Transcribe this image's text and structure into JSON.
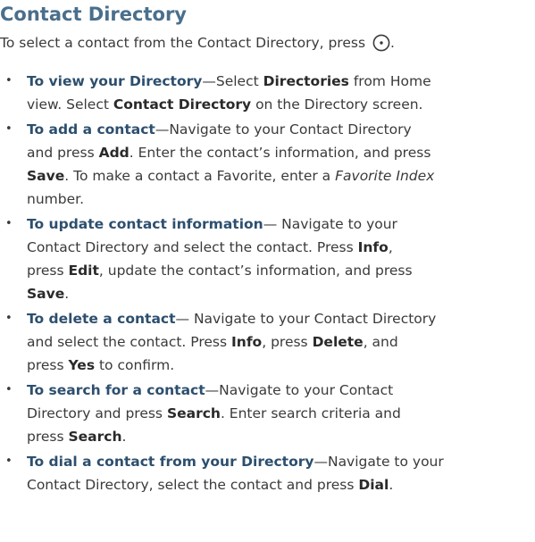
{
  "title": "Contact Directory",
  "intro": {
    "text": "To select a contact from the Contact Directory, press",
    "select_key_icon": "select-button-icon",
    "end": "."
  },
  "items": [
    {
      "lead": "To view your Directory",
      "lines": [
        [
          {
            "t": "—Select ",
            "k": false
          },
          {
            "t": "Directories",
            "k": true
          },
          {
            "t": " from Home",
            "k": false
          }
        ],
        [
          {
            "t": "view. Select ",
            "k": false
          },
          {
            "t": "Contact Directory",
            "k": true
          },
          {
            "t": " on the Directory screen.",
            "k": false
          }
        ]
      ]
    },
    {
      "lead": "To add a contact",
      "lines": [
        [
          {
            "t": "—Navigate to your Contact Directory",
            "k": false
          }
        ],
        [
          {
            "t": "and press ",
            "k": false
          },
          {
            "t": "Add",
            "k": true
          },
          {
            "t": ". Enter the contact’s information, and press",
            "k": false
          }
        ],
        [
          {
            "t": "Save",
            "k": true
          },
          {
            "t": ". To make a contact a Favorite, enter a ",
            "k": false
          },
          {
            "t": "Favorite Index",
            "k": false,
            "i": true
          }
        ],
        [
          {
            "t": "number.",
            "k": false
          }
        ]
      ]
    },
    {
      "lead": "To update contact information",
      "lines": [
        [
          {
            "t": "— Navigate to your",
            "k": false
          }
        ],
        [
          {
            "t": "Contact Directory and select the contact. Press ",
            "k": false
          },
          {
            "t": "Info",
            "k": true
          },
          {
            "t": ",",
            "k": false
          }
        ],
        [
          {
            "t": "press ",
            "k": false
          },
          {
            "t": "Edit",
            "k": true
          },
          {
            "t": ", update the contact’s information, and press",
            "k": false
          }
        ],
        [
          {
            "t": "Save",
            "k": true
          },
          {
            "t": ".",
            "k": false
          }
        ]
      ]
    },
    {
      "lead": "To delete a contact",
      "lines": [
        [
          {
            "t": "— Navigate to your Contact Directory",
            "k": false
          }
        ],
        [
          {
            "t": "and select the contact. Press ",
            "k": false
          },
          {
            "t": "Info",
            "k": true
          },
          {
            "t": ", press ",
            "k": false
          },
          {
            "t": "Delete",
            "k": true
          },
          {
            "t": ", and",
            "k": false
          }
        ],
        [
          {
            "t": "press ",
            "k": false
          },
          {
            "t": "Yes",
            "k": true
          },
          {
            "t": " to confirm.",
            "k": false
          }
        ]
      ]
    },
    {
      "lead": "To search for a contact",
      "lines": [
        [
          {
            "t": "—Navigate to your Contact",
            "k": false
          }
        ],
        [
          {
            "t": "Directory and press ",
            "k": false
          },
          {
            "t": "Search",
            "k": true
          },
          {
            "t": ". Enter search criteria and",
            "k": false
          }
        ],
        [
          {
            "t": "press ",
            "k": false
          },
          {
            "t": "Search",
            "k": true
          },
          {
            "t": ".",
            "k": false
          }
        ]
      ]
    },
    {
      "lead": "To dial a contact from your Directory",
      "lines": [
        [
          {
            "t": "—Navigate to your",
            "k": false
          }
        ],
        [
          {
            "t": "Contact Directory, select the contact and press ",
            "k": false
          },
          {
            "t": "Dial",
            "k": true
          },
          {
            "t": ".",
            "k": false
          }
        ]
      ]
    }
  ],
  "colors": {
    "title": "#4a6f8c",
    "lead": "#2d4f6e",
    "body": "#3a3a3a"
  }
}
